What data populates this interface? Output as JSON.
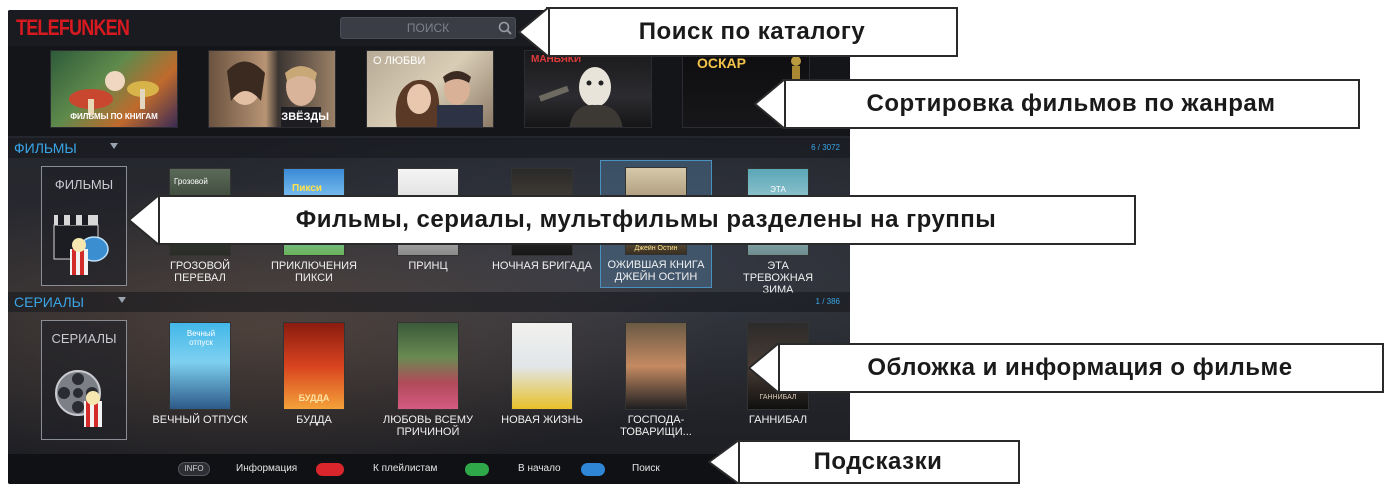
{
  "app": {
    "logo": "TELEFUNKEN",
    "search_placeholder": "ПОИСК"
  },
  "genres": [
    {
      "label": "ФИЛЬМЫ ПО КНИГАМ"
    },
    {
      "label": "ЗВЁЗДЫ"
    },
    {
      "label": "О ЛЮБВИ"
    },
    {
      "label": "МАНЬЯКИ"
    },
    {
      "label": "ОСКАР"
    }
  ],
  "films": {
    "section_title": "ФИЛЬМЫ",
    "count": "6 / 3072",
    "category_label": "ФИЛЬМЫ",
    "items": [
      {
        "title": "ГРОЗОВОЙ ПЕРЕВАЛ",
        "poster_text": "Грозовой"
      },
      {
        "title": "ПРИКЛЮЧЕНИЯ ПИКСИ",
        "poster_text": "Пикси"
      },
      {
        "title": "ПРИНЦ",
        "poster_text": ""
      },
      {
        "title": "НОЧНАЯ БРИГАДА",
        "poster_text": ""
      },
      {
        "title": "ОЖИВШАЯ КНИГА ДЖЕЙН ОСТИН",
        "poster_text": "Джейн Остин"
      },
      {
        "title": "ЭТА ТРЕВОЖНАЯ ЗИМА",
        "poster_text": "ЭТА"
      }
    ]
  },
  "series": {
    "section_title": "СЕРИАЛЫ",
    "count": "1 / 386",
    "category_label": "СЕРИАЛЫ",
    "items": [
      {
        "title": "ВЕЧНЫЙ ОТПУСК",
        "poster_text": "Вечный отпуск"
      },
      {
        "title": "БУДДА",
        "poster_text": "БУДДА"
      },
      {
        "title": "ЛЮБОВЬ ВСЕМУ ПРИЧИНОЙ",
        "poster_text": ""
      },
      {
        "title": "НОВАЯ ЖИЗНЬ",
        "poster_text": ""
      },
      {
        "title": "ГОСПОДА-ТОВАРИЩИ...",
        "poster_text": ""
      },
      {
        "title": "ГАННИБАЛ",
        "poster_text": "ГАННИБАЛ"
      }
    ]
  },
  "hints": {
    "info_badge": "INFO",
    "info": "Информация",
    "playlists": "К плейлистам",
    "home": "В начало",
    "search": "Поиск"
  },
  "callouts": {
    "search": "Поиск по каталогу",
    "genres": "Сортировка фильмов по жанрам",
    "groups": "Фильмы, сериалы, мультфильмы разделены на группы",
    "cover": "Обложка и информация о фильме",
    "hints": "Подсказки"
  },
  "colors": {
    "accent_blue": "#3aa6e8",
    "brand_red": "#d71920",
    "hint_red": "#d9262c",
    "hint_green": "#2fa84a",
    "hint_blue": "#2f86d6"
  }
}
